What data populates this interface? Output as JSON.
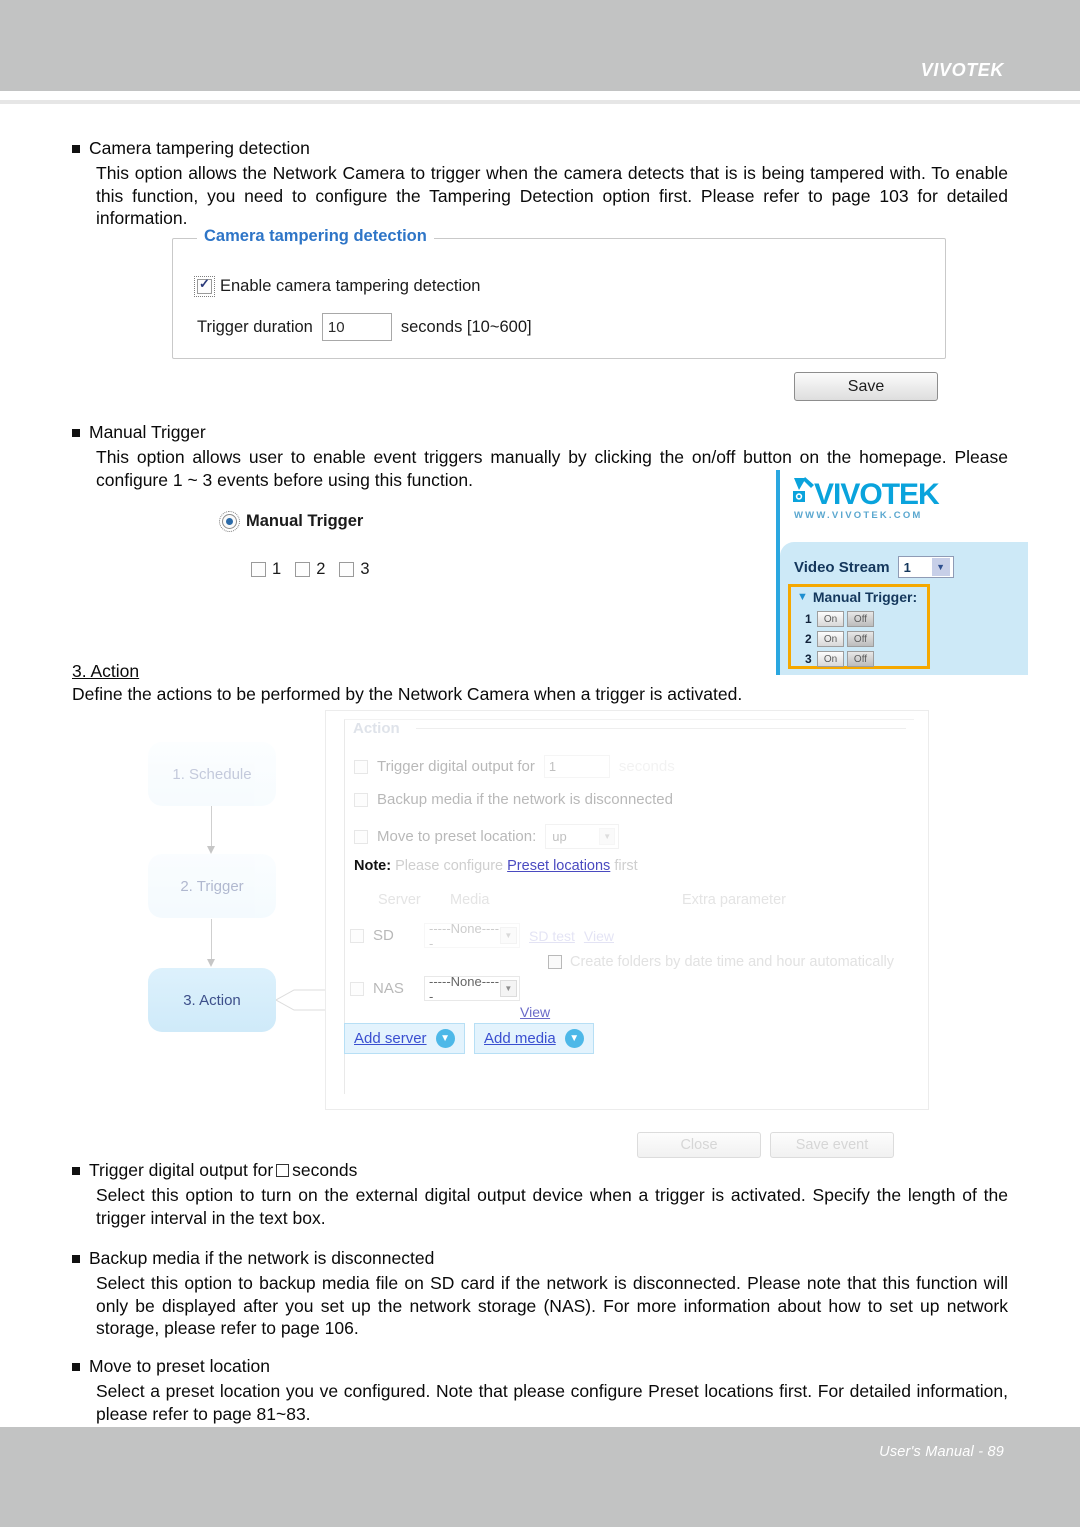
{
  "header": {
    "brand": "VIVOTEK"
  },
  "footer": {
    "text": "User's Manual - 89"
  },
  "sections": {
    "tampering": {
      "heading": "Camera tampering detection",
      "body": "This option allows the Network Camera to trigger when the camera detects that is is being tampered with. To enable this function, you need to configure the Tampering Detection option first. Please refer to page 103 for detailed information."
    },
    "manual_trigger": {
      "heading": "Manual Trigger",
      "body": "This option allows user to enable event triggers manually by clicking the on/off button on the homepage. Please configure 1 ~ 3 events before using this function."
    },
    "action": {
      "title": "3. Action",
      "subtitle": "Define the actions to be performed by the Network Camera when a trigger is activated."
    },
    "trigger_digital_output": {
      "heading_before": "Trigger digital output for",
      "heading_after": "seconds",
      "body": "Select this option to turn on the external digital output device when a trigger is activated. Specify the length of the trigger interval in the text box."
    },
    "backup_media": {
      "heading": "Backup media if the network is disconnected",
      "body": "Select this option to backup media file on SD card if the network is disconnected. Please note that this function will only be displayed after you set up the network storage (NAS). For more information about how to set up network storage, please refer to page 106."
    },
    "move_preset": {
      "heading": "Move to preset location",
      "body": "Select a preset location you ve configured. Note that please configure Preset locations   first. For detailed information, please refer to page 81~83."
    }
  },
  "tamper_widget": {
    "legend": "Camera tampering detection",
    "enable_label": "Enable camera tampering detection",
    "enable_checked": true,
    "duration_label": "Trigger duration",
    "duration_value": "10",
    "duration_units": "seconds [10~600]",
    "save_label": "Save"
  },
  "manual_trigger_widget": {
    "radio_label": "Manual Trigger",
    "radio_selected": true,
    "checkboxes": [
      {
        "label": "1",
        "checked": false
      },
      {
        "label": "2",
        "checked": false
      },
      {
        "label": "3",
        "checked": false
      }
    ]
  },
  "vivotek_panel": {
    "logo_text": "VIVOTEK",
    "logo_url": "WWW.VIVOTEK.COM",
    "video_stream_label": "Video Stream",
    "video_stream_value": "1",
    "manual_trigger_label": "Manual Trigger:",
    "rows": [
      {
        "num": "1",
        "on": "On",
        "off": "Off"
      },
      {
        "num": "2",
        "on": "On",
        "off": "Off"
      },
      {
        "num": "3",
        "on": "On",
        "off": "Off"
      }
    ],
    "highlight_color": "#f5a800",
    "accent_color": "#2aa7e0",
    "panel_color": "#cde9f7"
  },
  "action_dialog": {
    "legend": "Action",
    "trigger_do_label": "Trigger digital output for",
    "trigger_do_value": "1",
    "trigger_do_units": "seconds",
    "backup_media_label": "Backup media if the network is disconnected",
    "move_preset_label": "Move to preset location:",
    "move_preset_value": "up",
    "note_label": "Note:",
    "note_text_1": "Please configure",
    "note_link": "Preset locations",
    "note_text_2": "first",
    "table_headers": [
      "Server",
      "Media",
      "Extra parameter"
    ],
    "sd_label": "SD",
    "sd_value": "-----None-----",
    "sd_test_link": "SD test",
    "sd_view_link": "View",
    "nas_label": "NAS",
    "nas_value": "-----None-----",
    "nas_view_link": "View",
    "create_folders_label": "Create folders by date time and hour automatically",
    "add_server_label": "Add server",
    "add_media_label": "Add media",
    "close_label": "Close",
    "save_event_label": "Save event"
  },
  "flowchart": {
    "nodes": [
      {
        "label": "1. Schedule"
      },
      {
        "label": "2. Trigger"
      },
      {
        "label": "3. Action"
      }
    ]
  }
}
